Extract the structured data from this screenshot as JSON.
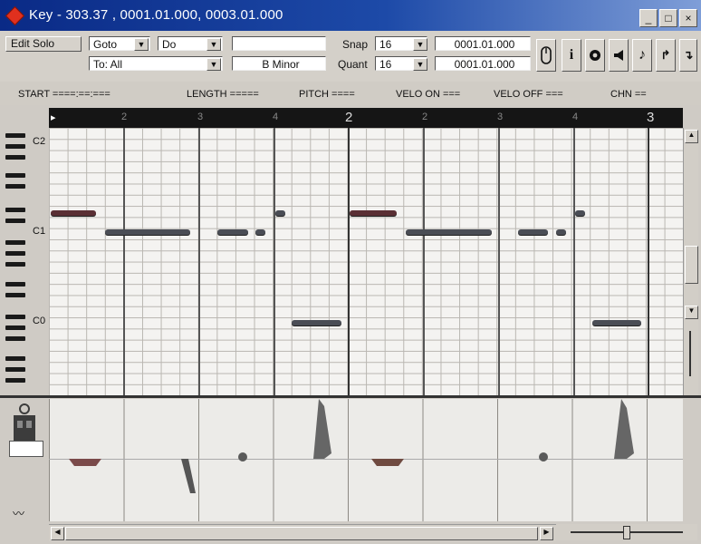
{
  "window": {
    "title": "Key - 303.37 , 0001.01.000, 0003.01.000"
  },
  "toolbar": {
    "edit_solo": "Edit Solo",
    "goto": "Goto",
    "do": "Do",
    "to": "To: All",
    "key": "B Minor",
    "snap_label": "Snap",
    "snap_value": "16",
    "quant_label": "Quant",
    "quant_value": "16",
    "pos1": "0001.01.000",
    "pos2": "0001.01.000",
    "icons": [
      "mouse-icon",
      "info-icon",
      "solo-icon",
      "speaker-icon",
      "note-icon",
      "step-up-icon",
      "step-down-icon"
    ]
  },
  "info_line": {
    "start": "START ====:==:===",
    "length": "LENGTH =====",
    "pitch": "PITCH ====",
    "velo_on": "VELO ON ===",
    "velo_off": "VELO OFF ===",
    "chn": "CHN =="
  },
  "ruler": {
    "marks": [
      "2",
      "3",
      "4",
      "2",
      "2",
      "3",
      "4",
      "3"
    ]
  },
  "keyboard": {
    "labels": [
      "C2",
      "C1",
      "C0"
    ]
  },
  "colors": {
    "titlebar": "#0a2a86",
    "note": "#4a4d55",
    "grid_bg": "#f4f3f1"
  }
}
